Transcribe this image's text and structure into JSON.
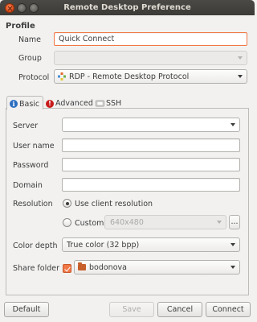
{
  "window": {
    "title": "Remote Desktop Preference"
  },
  "profile": {
    "heading": "Profile",
    "name_label": "Name",
    "name_value": "Quick Connect",
    "group_label": "Group",
    "group_value": "",
    "protocol_label": "Protocol",
    "protocol_value": "RDP - Remote Desktop Protocol"
  },
  "tabs": [
    {
      "label": "Basic",
      "icon": "info-icon",
      "active": true
    },
    {
      "label": "Advanced",
      "icon": "warning-icon",
      "active": false
    },
    {
      "label": "SSH",
      "icon": "ssh-icon",
      "active": false
    }
  ],
  "basic": {
    "server_label": "Server",
    "server_value": "",
    "username_label": "User name",
    "username_value": "",
    "password_label": "Password",
    "password_value": "",
    "domain_label": "Domain",
    "domain_value": "",
    "resolution_label": "Resolution",
    "use_client_label": "Use client resolution",
    "custom_label": "Custom",
    "custom_value": "640x480",
    "browse_label": "...",
    "color_depth_label": "Color depth",
    "color_depth_value": "True color (32 bpp)",
    "share_folder_label": "Share folder",
    "share_folder_value": "bodonova"
  },
  "buttons": {
    "default": "Default",
    "save": "Save",
    "cancel": "Cancel",
    "connect": "Connect"
  },
  "colors": {
    "accent": "#f07746",
    "titlebar": "#3c3b37",
    "background": "#f2f1f0"
  }
}
